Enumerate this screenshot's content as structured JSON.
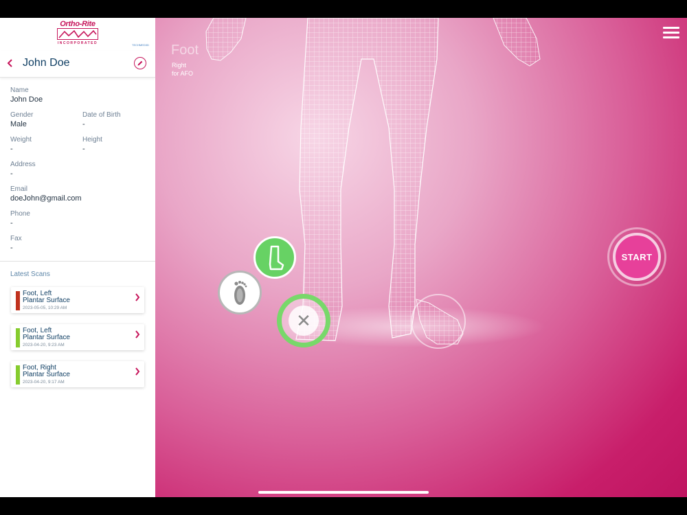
{
  "brand": {
    "name": "Ortho-Rite",
    "incorporated": "INCORPORATED",
    "tech_tag": "TECHMED3D"
  },
  "patient": {
    "header_name": "John Doe",
    "fields": {
      "name_label": "Name",
      "name_value": "John Doe",
      "gender_label": "Gender",
      "gender_value": "Male",
      "dob_label": "Date of Birth",
      "dob_value": "-",
      "weight_label": "Weight",
      "weight_value": "-",
      "height_label": "Height",
      "height_value": "-",
      "address_label": "Address",
      "address_value": "-",
      "email_label": "Email",
      "email_value": "doeJohn@gmail.com",
      "phone_label": "Phone",
      "phone_value": "-",
      "fax_label": "Fax",
      "fax_value": "-"
    }
  },
  "latest_scans": {
    "title": "Latest Scans",
    "items": [
      {
        "title": "Foot, Left",
        "surface": "Plantar Surface",
        "date": "2023-05-05, 10:29 AM",
        "color": "#c0321e"
      },
      {
        "title": "Foot, Left",
        "surface": "Plantar Surface",
        "date": "2023-04-20, 9:23 AM",
        "color": "#86cc2e"
      },
      {
        "title": "Foot, Right",
        "surface": "Plantar Surface",
        "date": "2023-04-20, 9:17 AM",
        "color": "#86cc2e"
      }
    ]
  },
  "main": {
    "mode_title": "Foot",
    "mode_side": "Right",
    "mode_purpose": "for AFO",
    "start_label": "START",
    "close_glyph": "✕"
  },
  "colors": {
    "accent": "#c6145a",
    "scan_green": "#86cc2e",
    "scan_red": "#c0321e",
    "button_green": "#67d264"
  },
  "icons": {
    "back": "chevron-left-icon",
    "edit": "pencil-icon",
    "menu": "hamburger-menu-icon",
    "afo": "sock-icon",
    "plantar": "footprint-icon",
    "close": "close-icon"
  }
}
